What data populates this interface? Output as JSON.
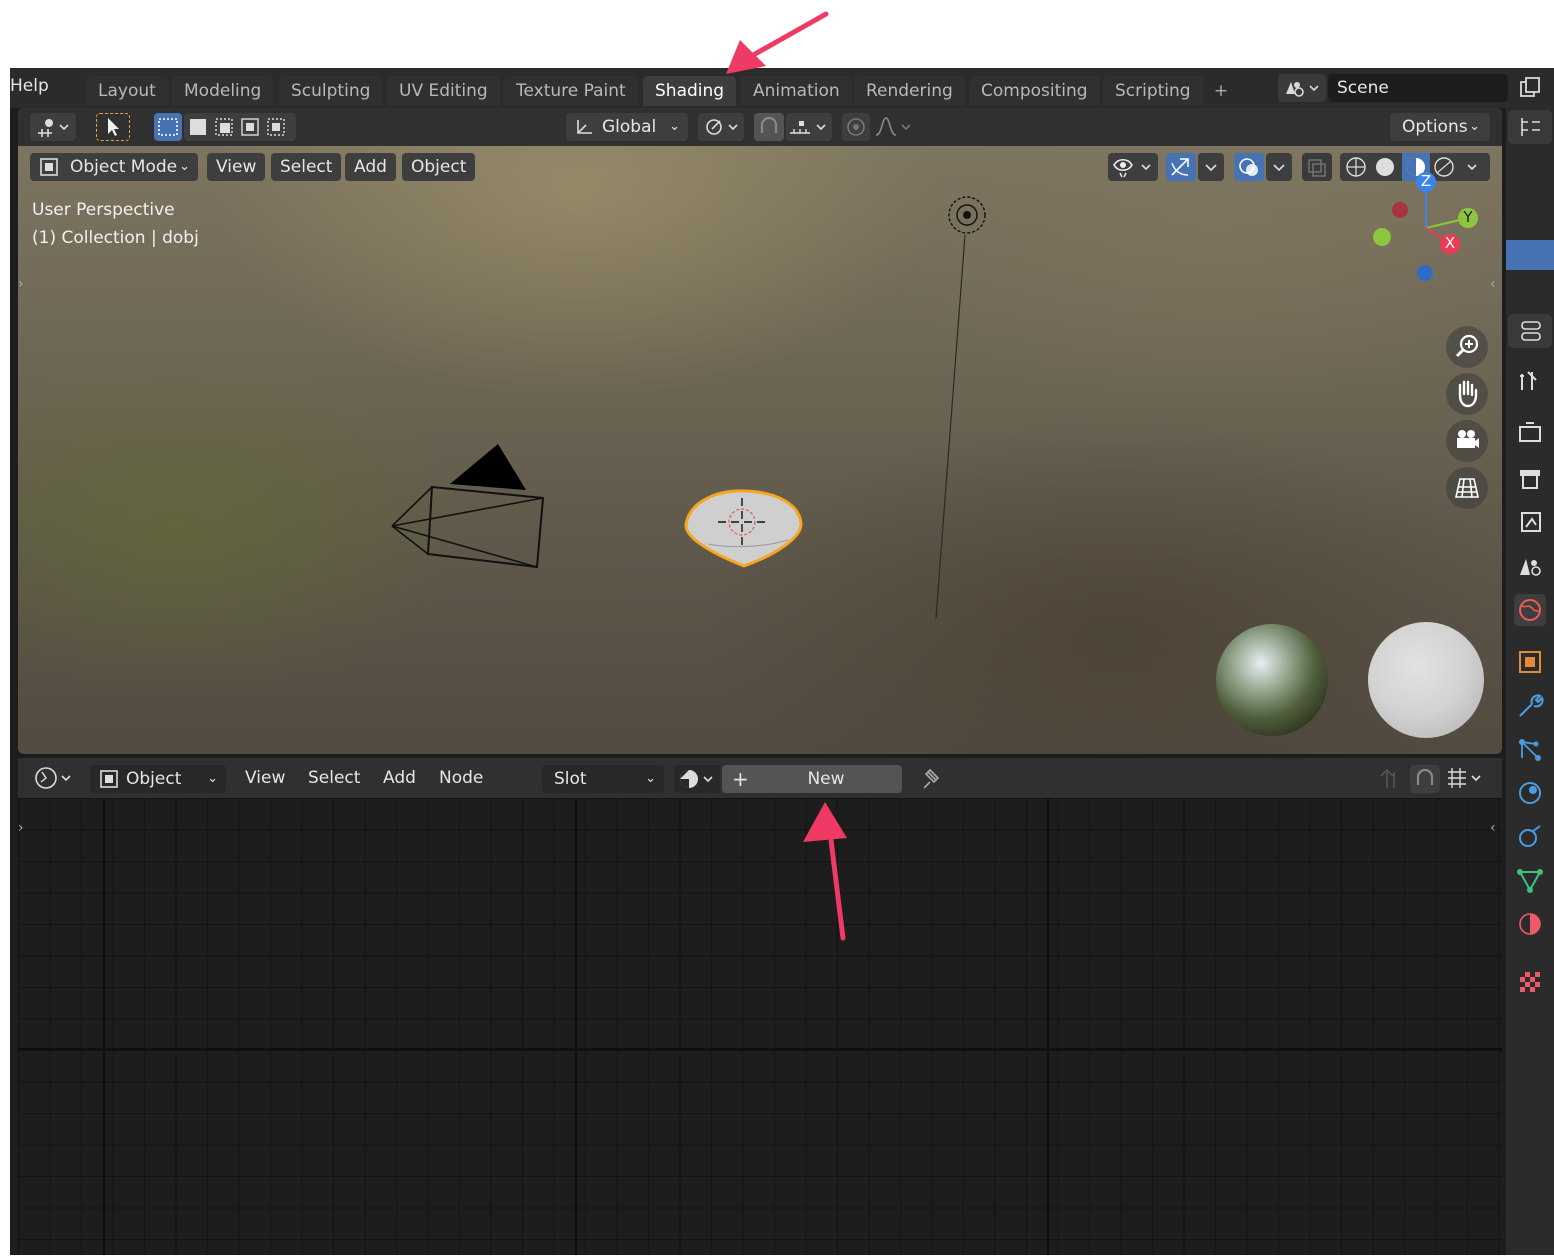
{
  "menu": {
    "help": "Help"
  },
  "workspace_tabs": [
    {
      "label": "Layout",
      "active": false
    },
    {
      "label": "Modeling",
      "active": false
    },
    {
      "label": "Sculpting",
      "active": false
    },
    {
      "label": "UV Editing",
      "active": false
    },
    {
      "label": "Texture Paint",
      "active": false
    },
    {
      "label": "Shading",
      "active": true
    },
    {
      "label": "Animation",
      "active": false
    },
    {
      "label": "Rendering",
      "active": false
    },
    {
      "label": "Compositing",
      "active": false
    },
    {
      "label": "Scripting",
      "active": false
    }
  ],
  "add_workspace": "+",
  "scene": {
    "name": "Scene"
  },
  "viewport_header": {
    "transform_orientation": "Global",
    "options_label": "Options",
    "mode": "Object Mode",
    "menus": [
      "View",
      "Select",
      "Add",
      "Object"
    ]
  },
  "viewport_overlay": {
    "view_name": "User Perspective",
    "collection_info": "(1) Collection | dobj"
  },
  "gizmo_axes": {
    "z": "Z",
    "y": "Y",
    "x": "X"
  },
  "node_editor": {
    "object_type": "Object",
    "menus": [
      "View",
      "Select",
      "Add",
      "Node"
    ],
    "slot_label": "Slot",
    "new_plus": "+",
    "new_label": "New"
  },
  "colors": {
    "accent_blue": "#4772b3",
    "annotation_arrow": "#ee3a64",
    "selection_orange": "#f5a623",
    "axis_x": "#ee3a54",
    "axis_y": "#8cc63f",
    "axis_z": "#3c84e8"
  },
  "icons": {
    "properties": [
      "tool-icon",
      "render-icon",
      "output-icon",
      "view-layer-icon",
      "scene-icon",
      "world-icon",
      "object-icon",
      "modifier-icon",
      "particles-icon",
      "physics-icon",
      "constraints-icon",
      "data-icon",
      "material-icon",
      "texture-icon"
    ]
  }
}
